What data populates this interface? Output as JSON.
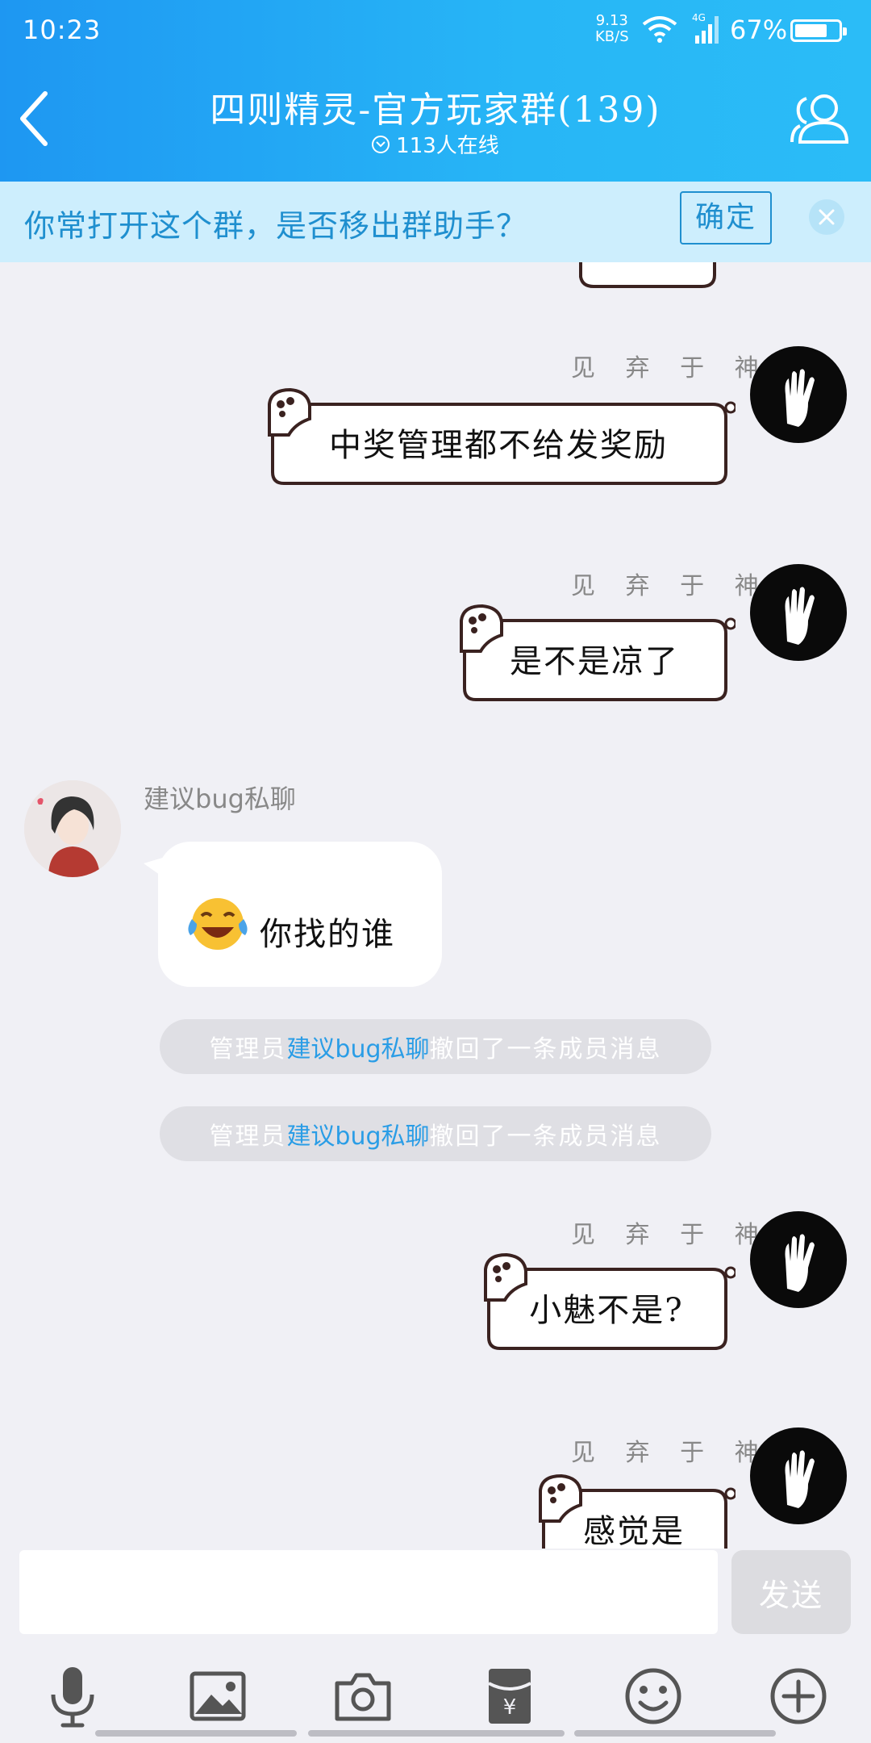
{
  "status_bar": {
    "time": "10:23",
    "net_speed_value": "9.13",
    "net_speed_unit": "KB/S",
    "network": "4G",
    "battery": "67%"
  },
  "header": {
    "title": "四则精灵-官方玩家群(139)",
    "online": "113人在线"
  },
  "notice": {
    "text": "你常打开这个群，是否移出群助手？",
    "confirm": "确定"
  },
  "messages": [
    {
      "sender": "见 弃 于 神",
      "text": "中奖管理都不给发奖励"
    },
    {
      "sender": "见 弃 于 神",
      "text": "是不是凉了"
    },
    {
      "sender": "建议bug私聊",
      "text": "你找的谁"
    },
    {
      "sender": "见 弃 于 神",
      "text": "小魅不是?"
    },
    {
      "sender": "见 弃 于 神",
      "text": "感觉是"
    }
  ],
  "system_messages": [
    {
      "prefix": "管理员",
      "link": "建议bug私聊",
      "suffix": "撤回了一条成员消息"
    },
    {
      "prefix": "管理员",
      "link": "建议bug私聊",
      "suffix": "撤回了一条成员消息"
    }
  ],
  "input": {
    "send": "发送"
  },
  "toolbar": [
    "mic-icon",
    "image-icon",
    "camera-icon",
    "red-packet-icon",
    "emoji-icon",
    "plus-icon"
  ]
}
